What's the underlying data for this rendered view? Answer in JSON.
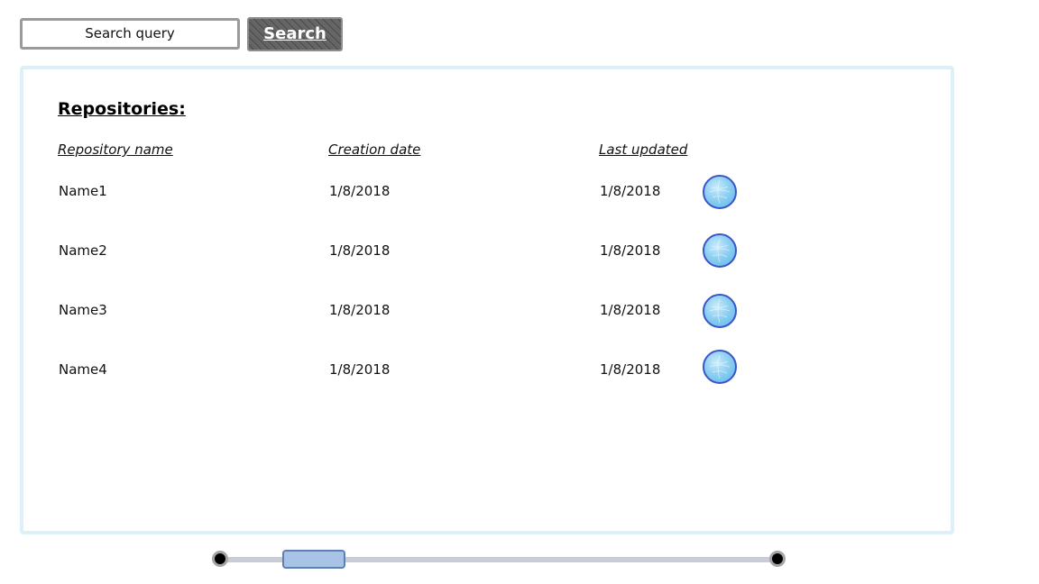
{
  "search": {
    "placeholder": "Search query",
    "button_label": "Search"
  },
  "panel": {
    "title": "Repositories:",
    "columns": [
      "Repository name",
      "Creation date",
      "Last updated"
    ],
    "rows": [
      {
        "name": "Name1",
        "created": "1/8/2018",
        "updated": "1/8/2018"
      },
      {
        "name": "Name2",
        "created": "1/8/2018",
        "updated": "1/8/2018"
      },
      {
        "name": "Name3",
        "created": "1/8/2018",
        "updated": "1/8/2018"
      },
      {
        "name": "Name4",
        "created": "1/8/2018",
        "updated": "1/8/2018"
      }
    ],
    "row_action_icon": "globe-icon"
  },
  "colors": {
    "panel_border": "#ddf0f9",
    "button_bg": "#5a5a5a",
    "row_button_border": "#3a55c8",
    "row_button_fill": "#8fd0f2",
    "scroll_thumb": "#a8c3e6"
  }
}
